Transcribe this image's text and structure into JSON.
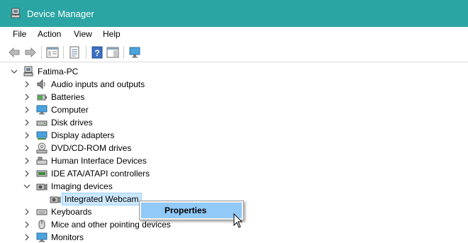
{
  "window": {
    "title": "Device Manager",
    "icon": "device-manager-icon"
  },
  "menu": [
    "File",
    "Action",
    "View",
    "Help"
  ],
  "toolbar": [
    "back-arrow-icon",
    "forward-arrow-icon",
    "show-hide-console-tree-icon",
    "properties-icon",
    "help-icon",
    "action-pane-icon",
    "monitor-icon"
  ],
  "tree": {
    "root": "Fatima-PC",
    "items": [
      {
        "label": "Audio inputs and outputs",
        "icon": "speaker-icon"
      },
      {
        "label": "Batteries",
        "icon": "battery-icon"
      },
      {
        "label": "Computer",
        "icon": "computer-icon"
      },
      {
        "label": "Disk drives",
        "icon": "disk-drive-icon"
      },
      {
        "label": "Display adapters",
        "icon": "display-adapter-icon"
      },
      {
        "label": "DVD/CD-ROM drives",
        "icon": "dvd-drive-icon"
      },
      {
        "label": "Human Interface Devices",
        "icon": "hid-icon"
      },
      {
        "label": "IDE ATA/ATAPI controllers",
        "icon": "ide-controller-icon"
      },
      {
        "label": "Imaging devices",
        "icon": "camera-icon"
      },
      {
        "label": "Integrated Webcam",
        "icon": "webcam-icon"
      },
      {
        "label": "Keyboards",
        "icon": "keyboard-icon"
      },
      {
        "label": "Mice and other pointing devices",
        "icon": "mouse-icon"
      },
      {
        "label": "Monitors",
        "icon": "monitor-icon"
      }
    ]
  },
  "context_menu": {
    "item": "Properties"
  },
  "colors": {
    "titlebar": "#2aa5a3",
    "selection": "#cce8ff",
    "menu_highlight": "#91c9f7"
  }
}
